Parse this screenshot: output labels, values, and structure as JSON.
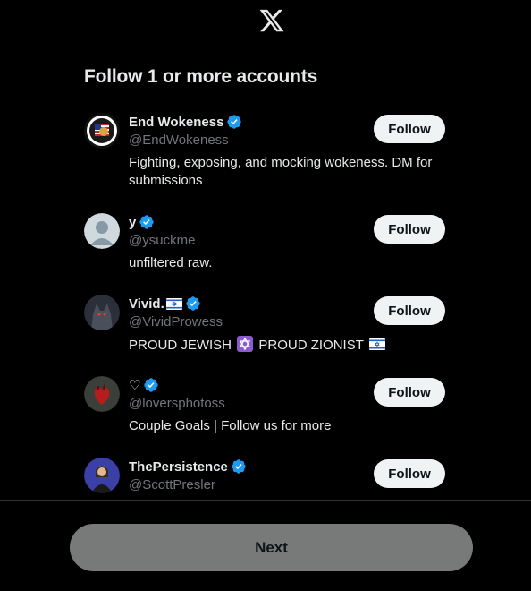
{
  "header": {
    "logo_icon": "x-logo-icon"
  },
  "title": "Follow 1 or more accounts",
  "accounts": [
    {
      "name": "End Wokeness",
      "handle": "@EndWokeness",
      "bio": "Fighting, exposing, and mocking wokeness. DM for submissions",
      "verified": true,
      "follow_label": "Follow"
    },
    {
      "name": "y",
      "handle": "@ysuckme",
      "bio": "unfiltered raw.",
      "verified": true,
      "follow_label": "Follow"
    },
    {
      "name": "Vivid.",
      "handle": "@VividProwess",
      "bio_part1": "PROUD JEWISH",
      "bio_part2": "PROUD ZIONIST",
      "verified": true,
      "follow_label": "Follow"
    },
    {
      "name": "♡",
      "handle": "@loversphotoss",
      "bio": "Couple Goals | Follow us for more",
      "verified": true,
      "follow_label": "Follow"
    },
    {
      "name": "ThePersistence",
      "handle": "@ScottPresler",
      "verified": true,
      "follow_label": "Follow"
    }
  ],
  "next_label": "Next",
  "colors": {
    "background": "#000000",
    "verified": "#1d9bf0",
    "follow_bg": "#eff3f4",
    "next_bg": "#787a7a",
    "muted": "#71767b"
  }
}
